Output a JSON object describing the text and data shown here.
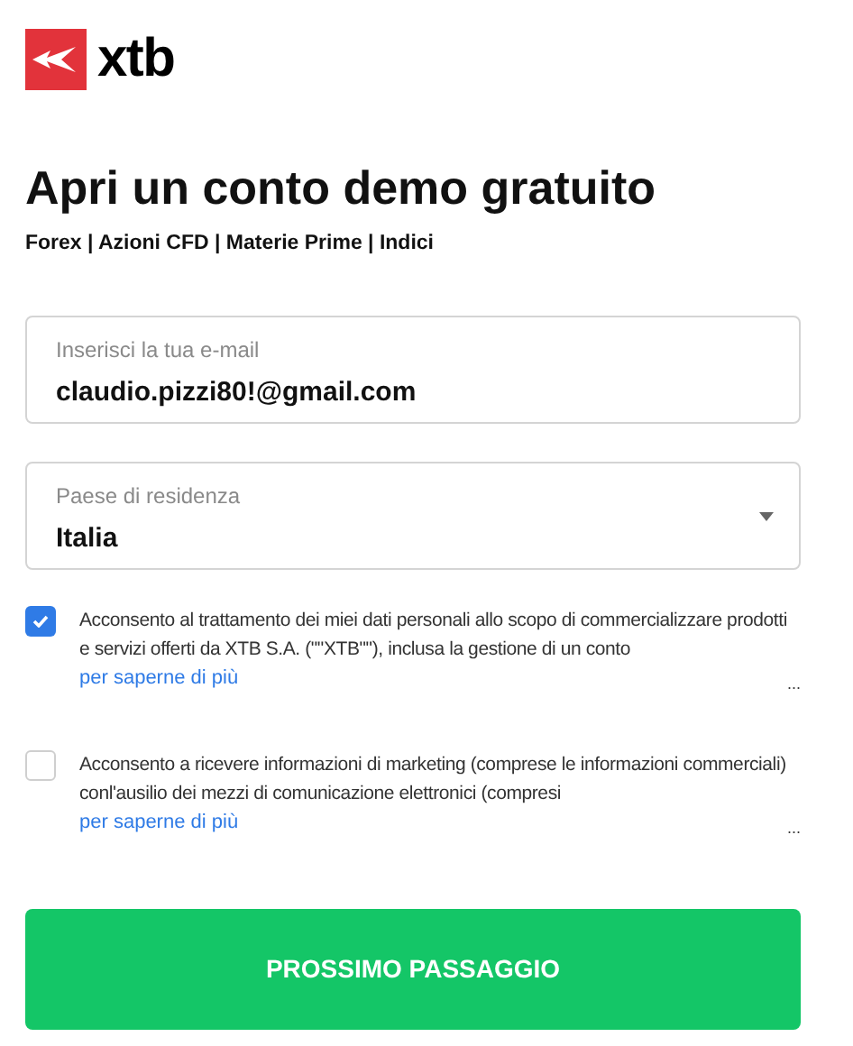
{
  "logo": {
    "text": "xtb"
  },
  "title": "Apri un conto demo gratuito",
  "subtitle": "Forex | Azioni CFD | Materie Prime | Indici",
  "fields": [
    {
      "kind": "text",
      "label": "Inserisci la tua e-mail",
      "value": "claudio.pizzi80!@gmail.com"
    },
    {
      "kind": "select",
      "label": "Paese di residenza",
      "value": "Italia"
    }
  ],
  "consents": [
    {
      "checked": true,
      "text": "Acconsento al trattamento dei miei dati personali allo scopo di commercializzare prodotti e servizi offerti da XTB S.A. (\"\"XTB\"\"), inclusa la gestione di un conto",
      "link": "per saperne di più",
      "more": "..."
    },
    {
      "checked": false,
      "text": "Acconsento a ricevere informazioni di marketing (comprese le informazioni commerciali) conl'ausilio dei mezzi di comunicazione elettronici (compresi",
      "link": "per saperne di più",
      "more": "..."
    }
  ],
  "submit": "PROSSIMO PASSAGGIO"
}
